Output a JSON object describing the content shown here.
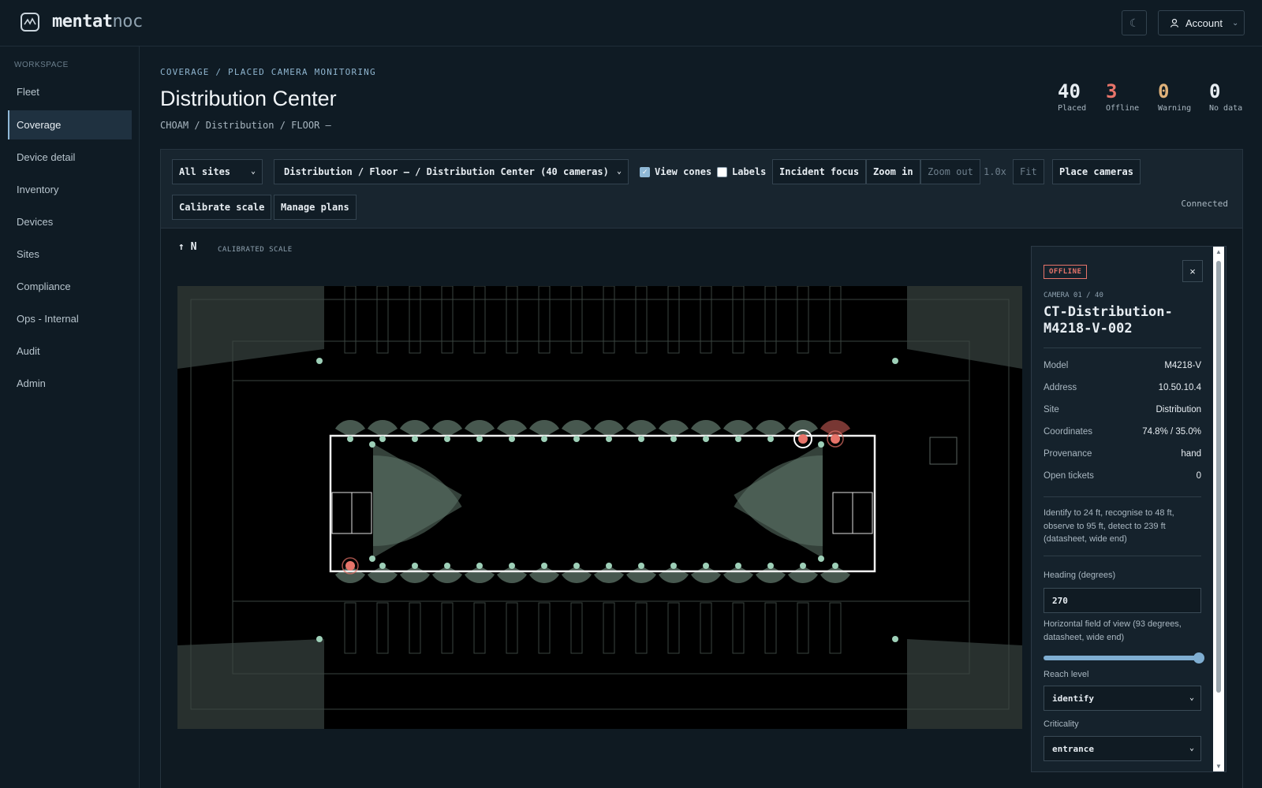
{
  "brand": {
    "name_main": "mentat",
    "name_accent": "noc"
  },
  "header": {
    "theme_icon": "moon-icon",
    "account_label": "Account"
  },
  "sidebar": {
    "section": "WORKSPACE",
    "items": [
      {
        "label": "Fleet",
        "active": false
      },
      {
        "label": "Coverage",
        "active": true
      },
      {
        "label": "Device detail",
        "active": false
      },
      {
        "label": "Inventory",
        "active": false
      },
      {
        "label": "Devices",
        "active": false
      },
      {
        "label": "Sites",
        "active": false
      },
      {
        "label": "Compliance",
        "active": false
      },
      {
        "label": "Ops - Internal",
        "active": false
      },
      {
        "label": "Audit",
        "active": false
      },
      {
        "label": "Admin",
        "active": false
      }
    ]
  },
  "page": {
    "crumb": "COVERAGE / PLACED CAMERA MONITORING",
    "title": "Distribution Center",
    "subcrumb": "CHOAM / Distribution / FLOOR –"
  },
  "stats": [
    {
      "value": "40",
      "label": "Placed",
      "color": "#e7edf2"
    },
    {
      "value": "3",
      "label": "Offline",
      "color": "#e8746a"
    },
    {
      "value": "0",
      "label": "Warning",
      "color": "#e0b27a"
    },
    {
      "value": "0",
      "label": "No data",
      "color": "#e7edf2"
    }
  ],
  "toolbar": {
    "site_select": "All sites",
    "plan_select": "Distribution / Floor – / Distribution Center (40 cameras)",
    "view_cones": {
      "label": "View cones",
      "checked": true
    },
    "labels": {
      "label": "Labels",
      "checked": false
    },
    "incident_focus": "Incident focus",
    "zoom_in": "Zoom in",
    "zoom_out": "Zoom out",
    "zoom_level": "1.0x",
    "fit": "Fit",
    "place_cameras": "Place cameras",
    "calibrate_scale": "Calibrate scale",
    "manage_plans": "Manage plans",
    "status": "Connected"
  },
  "map": {
    "north": "↑ N",
    "scale_label": "CALIBRATED SCALE",
    "colors": {
      "ok": "#9ed0b8",
      "offline": "#e8746a",
      "cone": "#5f7669"
    }
  },
  "detail": {
    "status": "OFFLINE",
    "close": "×",
    "index": "CAMERA 01 / 40",
    "name": "CT-Distribution-M4218-V-002",
    "rows": [
      {
        "k": "Model",
        "v": "M4218-V"
      },
      {
        "k": "Address",
        "v": "10.50.10.4"
      },
      {
        "k": "Site",
        "v": "Distribution"
      },
      {
        "k": "Coordinates",
        "v": "74.8% / 35.0%"
      },
      {
        "k": "Provenance",
        "v": "hand"
      },
      {
        "k": "Open tickets",
        "v": "0"
      }
    ],
    "description": "Identify to 24 ft, recognise to 48 ft, observe to 95 ft, detect to 239 ft (datasheet, wide end)",
    "heading_label": "Heading (degrees)",
    "heading_value": "270",
    "hfov_label": "Horizontal field of view (93 degrees, datasheet, wide end)",
    "hfov_fraction": 1.0,
    "reach_label": "Reach level",
    "reach_value": "identify",
    "criticality_label": "Criticality",
    "criticality_value": "entrance"
  }
}
